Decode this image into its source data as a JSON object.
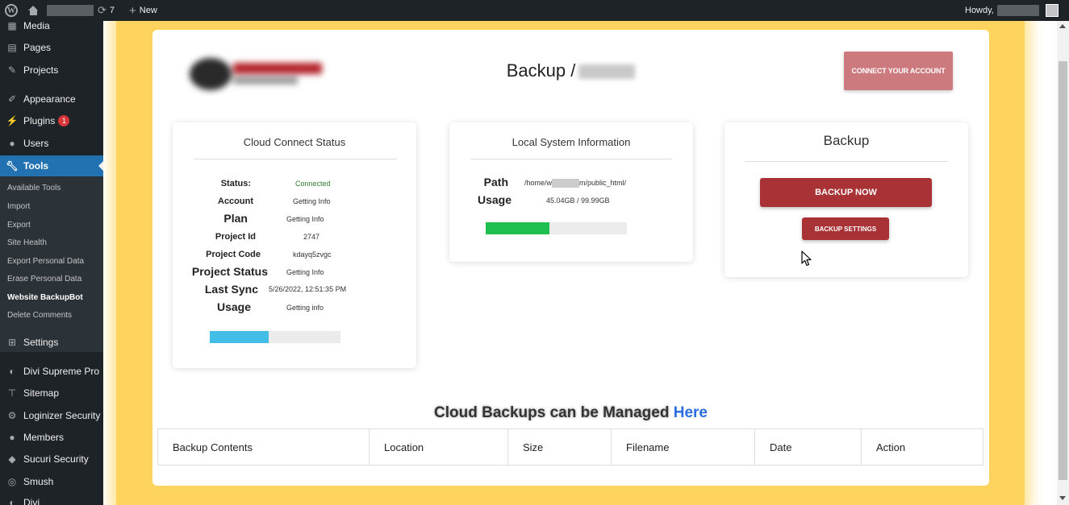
{
  "adminbar": {
    "updates_count": "7",
    "new_label": "New",
    "howdy": "Howdy,"
  },
  "sidebar": {
    "items": [
      {
        "label": "Media",
        "icon": "media-icon"
      },
      {
        "label": "Pages",
        "icon": "pages-icon"
      },
      {
        "label": "Projects",
        "icon": "pin-icon"
      },
      {
        "label": "Appearance",
        "icon": "brush-icon"
      },
      {
        "label": "Plugins",
        "icon": "plugin-icon",
        "badge": "1"
      },
      {
        "label": "Users",
        "icon": "users-icon"
      },
      {
        "label": "Tools",
        "icon": "wrench-icon"
      },
      {
        "label": "Settings",
        "icon": "settings-icon"
      },
      {
        "label": "Divi Supreme Pro",
        "icon": "divi-icon"
      },
      {
        "label": "Sitemap",
        "icon": "sitemap-icon"
      },
      {
        "label": "Loginizer Security",
        "icon": "gear-icon"
      },
      {
        "label": "Members",
        "icon": "members-icon"
      },
      {
        "label": "Sucuri Security",
        "icon": "shield-icon"
      },
      {
        "label": "Smush",
        "icon": "smush-icon"
      },
      {
        "label": "Divi",
        "icon": "divi-icon"
      }
    ],
    "submenu": [
      "Available Tools",
      "Import",
      "Export",
      "Site Health",
      "Export Personal Data",
      "Erase Personal Data",
      "Website BackupBot",
      "Delete Comments"
    ]
  },
  "panel": {
    "title": "Backup",
    "connect_button": "CONNECT YOUR ACCOUNT"
  },
  "cloud_status": {
    "title": "Cloud Connect Status",
    "rows": [
      {
        "label": "Status:",
        "value": "Connected"
      },
      {
        "label": "Account",
        "value": "Getting Info"
      },
      {
        "label": "Plan",
        "value": "Getting Info"
      },
      {
        "label": "Project Id",
        "value": "2747"
      },
      {
        "label": "Project Code",
        "value": "kdayq5zvgc"
      },
      {
        "label": "Project Status",
        "value": "Getting Info"
      },
      {
        "label": "Last Sync",
        "value": "5/26/2022, 12:51:35 PM"
      },
      {
        "label": "Usage",
        "value": "Getting info"
      }
    ],
    "usage_fraction": 0.45,
    "bar_color": "#42bde6"
  },
  "local_info": {
    "title": "Local System Information",
    "path_label": "Path",
    "path_prefix": "/home/w",
    "path_suffix": "m/public_html/",
    "usage_label": "Usage",
    "usage_value": "45.04GB / 99.99GB",
    "usage_fraction": 0.45,
    "bar_color": "#1fbf4f"
  },
  "backup_card": {
    "title": "Backup",
    "backup_now": "BACKUP NOW",
    "backup_settings": "BACKUP SETTINGS"
  },
  "cloud_heading": {
    "text": "Cloud Backups can be Managed",
    "link": "Here"
  },
  "table": {
    "headers": [
      "Backup Contents",
      "Location",
      "Size",
      "Filename",
      "Date",
      "Action"
    ]
  }
}
